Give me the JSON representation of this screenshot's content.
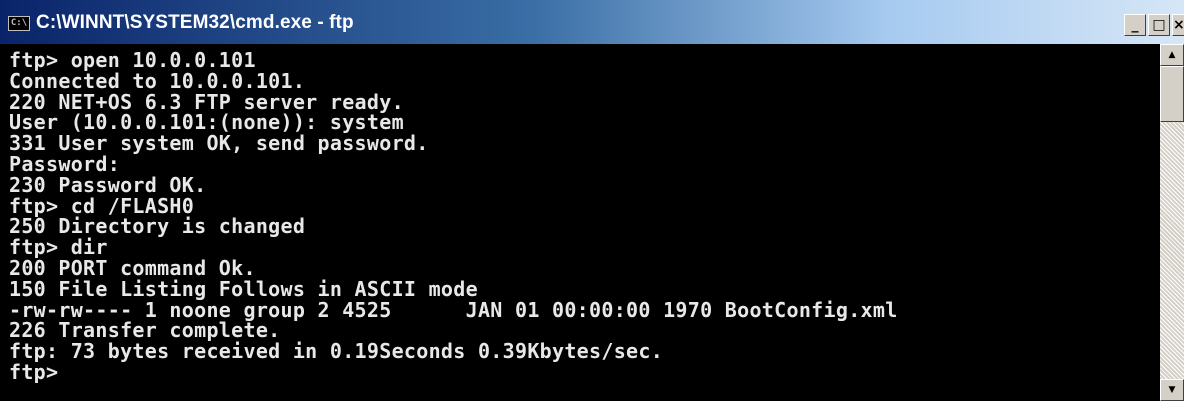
{
  "window": {
    "title": "C:\\WINNT\\SYSTEM32\\cmd.exe - ftp",
    "icon": "console-icon",
    "icon_text": "C:\\",
    "buttons": {
      "minimize": "_",
      "maximize": "□",
      "close": "×"
    }
  },
  "console": {
    "text": "ftp> open 10.0.0.101\nConnected to 10.0.0.101.\n220 NET+OS 6.3 FTP server ready.\nUser (10.0.0.101:(none)): system\n331 User system OK, send password.\nPassword:\n230 Password OK.\nftp> cd /FLASH0\n250 Directory is changed\nftp> dir\n200 PORT command Ok.\n150 File Listing Follows in ASCII mode\n-rw-rw---- 1 noone group 2 4525      JAN 01 00:00:00 1970 BootConfig.xml\n226 Transfer complete.\nftp: 73 bytes received in 0.19Seconds 0.39Kbytes/sec.\nftp>",
    "foreground": "#e8e8e8",
    "background": "#000000"
  },
  "scrollbar": {
    "up_arrow": "▲",
    "down_arrow": "▼"
  },
  "colors": {
    "titlebar_start": "#0a246a",
    "titlebar_end": "#d6e6f6",
    "chrome": "#d4d0c8"
  }
}
